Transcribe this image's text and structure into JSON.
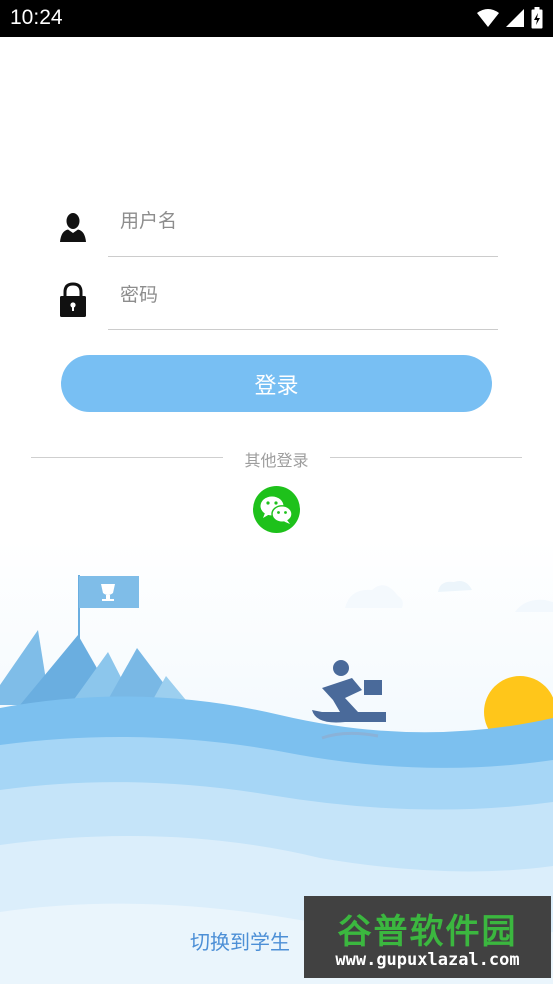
{
  "status_bar": {
    "time": "10:24",
    "icons": [
      "wifi-icon",
      "cellular-signal-icon",
      "battery-icon"
    ]
  },
  "login_form": {
    "username_placeholder": "用户名",
    "username_value": "",
    "username_icon": "user-icon",
    "password_placeholder": "密码",
    "password_value": "",
    "password_icon": "lock-icon",
    "login_button_label": "登录"
  },
  "other_login": {
    "label": "其他登录",
    "providers": [
      "wechat-icon"
    ]
  },
  "footer": {
    "switch_link_label": "切换到学生"
  },
  "watermark": {
    "title": "谷普软件园",
    "url": "www.gupuxlazal.com"
  },
  "colors": {
    "accent": "#78bff3",
    "wechat": "#1ec11b",
    "link": "#4c8fd6",
    "sun": "#ffc61a",
    "sky_light": "#eaf5fc"
  }
}
